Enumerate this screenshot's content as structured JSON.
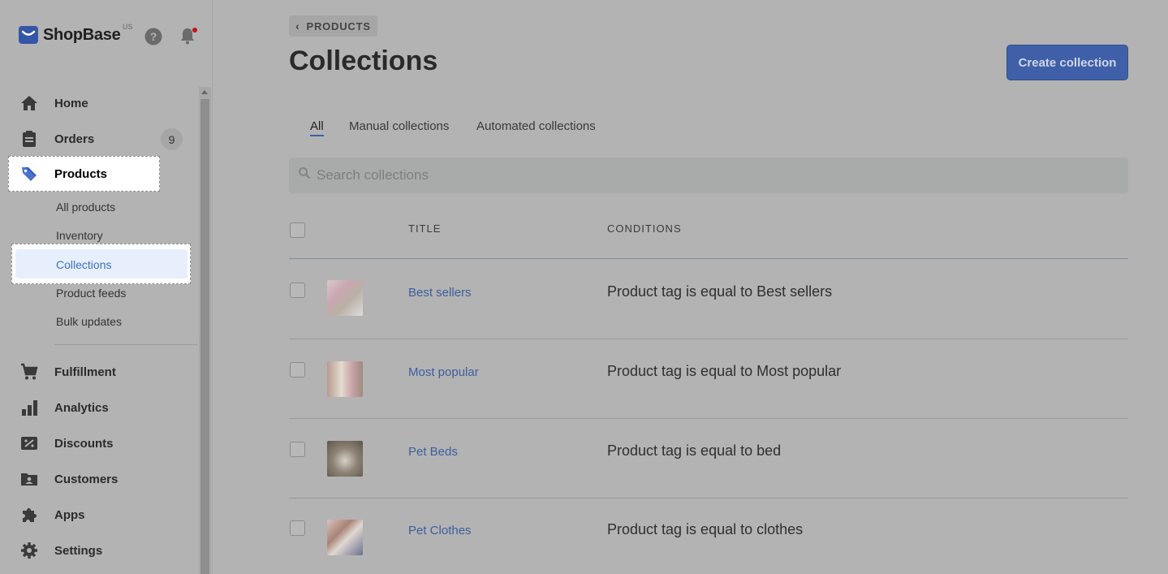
{
  "brand": {
    "name": "ShopBase",
    "region": "US"
  },
  "sidebar": {
    "items": [
      {
        "label": "Home",
        "icon": "home-icon"
      },
      {
        "label": "Orders",
        "icon": "orders-icon",
        "badge": "9"
      },
      {
        "label": "Products",
        "icon": "tag-icon"
      },
      {
        "label": "Fulfillment",
        "icon": "cart-icon"
      },
      {
        "label": "Analytics",
        "icon": "bar-chart-icon"
      },
      {
        "label": "Discounts",
        "icon": "discount-icon"
      },
      {
        "label": "Customers",
        "icon": "customers-icon"
      },
      {
        "label": "Apps",
        "icon": "puzzle-icon"
      },
      {
        "label": "Settings",
        "icon": "gear-icon"
      }
    ],
    "product_subitems": [
      "All products",
      "Inventory",
      "Collections",
      "Product feeds",
      "Bulk updates"
    ],
    "active_item": "Products",
    "active_subitem": "Collections"
  },
  "header": {
    "breadcrumb": "PRODUCTS",
    "title": "Collections",
    "create_button": "Create collection"
  },
  "tabs": [
    "All",
    "Manual collections",
    "Automated collections"
  ],
  "active_tab": "All",
  "search": {
    "placeholder": "Search collections",
    "value": ""
  },
  "table": {
    "columns": [
      "TITLE",
      "CONDITIONS"
    ],
    "rows": [
      {
        "title": "Best sellers",
        "condition": "Product tag is equal to Best sellers"
      },
      {
        "title": "Most popular",
        "condition": "Product tag is equal to Most popular"
      },
      {
        "title": "Pet Beds",
        "condition": "Product tag is equal to bed"
      },
      {
        "title": "Pet Clothes",
        "condition": "Product tag is equal to clothes"
      }
    ]
  },
  "colors": {
    "overlay_bg": "#b3b3b3",
    "accent": "#3f5fa8",
    "link": "#3d5e9e",
    "notification": "#c0151b"
  }
}
